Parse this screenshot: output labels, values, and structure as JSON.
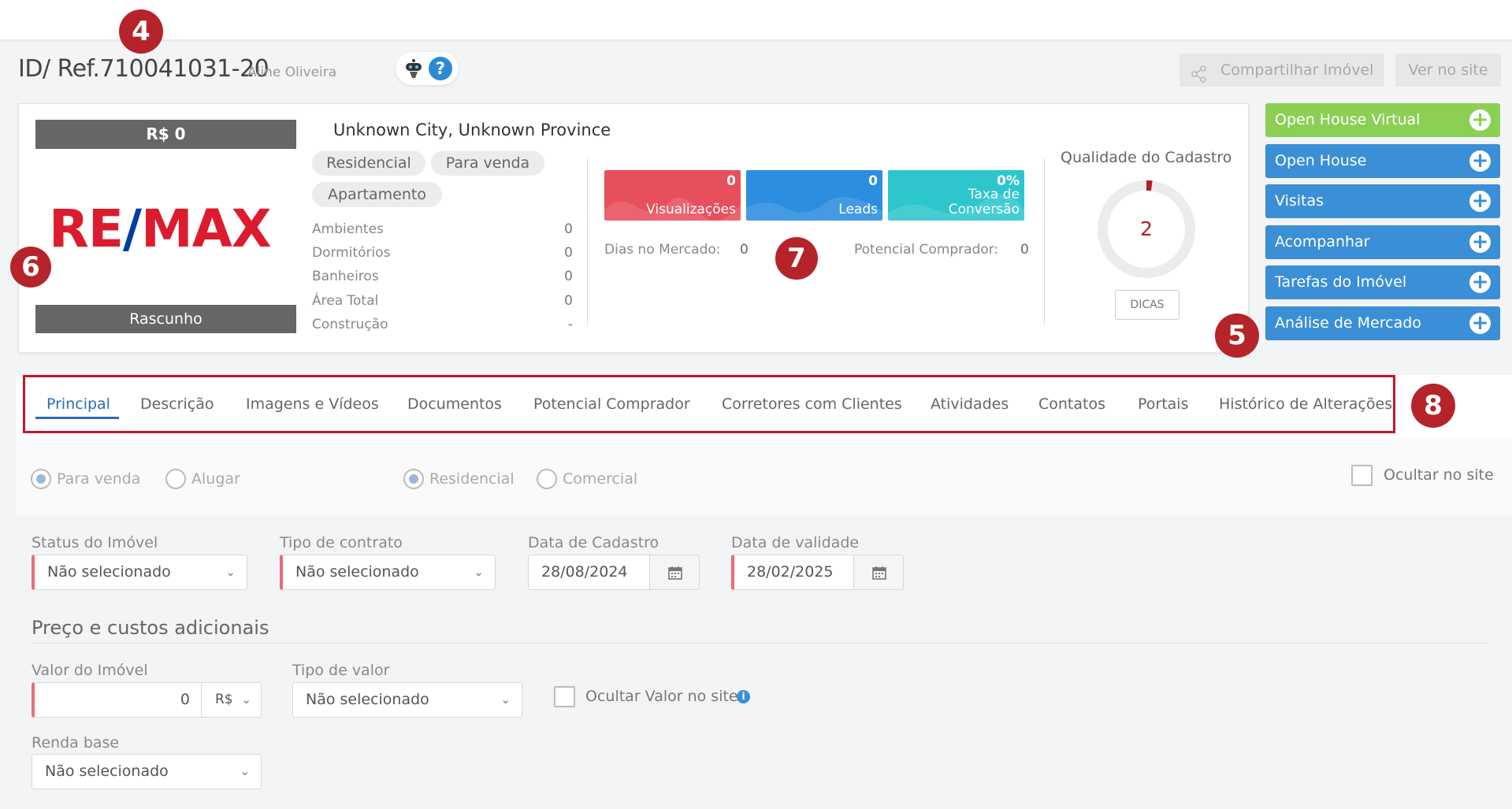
{
  "header": {
    "ref_title": "ID/ Ref.710041031-20",
    "agent_name": "Aline Oliveira",
    "share_label": "Compartilhar Imóvel",
    "view_site_label": "Ver no site"
  },
  "property": {
    "price": "R$ 0",
    "logo_left": "RE",
    "logo_slash": "/",
    "logo_right": "MAX",
    "status": "Rascunho",
    "location": "Unknown City, Unknown Province",
    "tags": [
      "Residencial",
      "Para venda",
      "Apartamento"
    ],
    "details": [
      {
        "label": "Ambientes",
        "value": "0"
      },
      {
        "label": "Dormitórios",
        "value": "0"
      },
      {
        "label": "Banheiros",
        "value": "0"
      },
      {
        "label": "Área Total",
        "value": "0"
      },
      {
        "label": "Construção",
        "value": "-"
      }
    ]
  },
  "stats": [
    {
      "value": "0",
      "label": "Visualizações",
      "color": "#e84f5c"
    },
    {
      "value": "0",
      "label": "Leads",
      "color": "#2c8ee0"
    },
    {
      "value": "0%",
      "label": "Taxa de Conversão",
      "color": "#2dc6cc"
    }
  ],
  "market": {
    "days_label": "Dias no Mercado:",
    "days_value": "0",
    "buyer_label": "Potencial Comprador:",
    "buyer_value": "0"
  },
  "quality": {
    "title": "Qualidade do Cadastro",
    "score": "2",
    "tips_label": "DICAS",
    "accent_color": "#b01f25"
  },
  "actions": [
    {
      "label": "Open House Virtual",
      "color": "#8bcf55"
    },
    {
      "label": "Open House",
      "color": "#3b8fd6"
    },
    {
      "label": "Visitas",
      "color": "#3b8fd6"
    },
    {
      "label": "Acompanhar",
      "color": "#3b8fd6"
    },
    {
      "label": "Tarefas do Imóvel",
      "color": "#3b8fd6"
    },
    {
      "label": "Análise de Mercado",
      "color": "#3b8fd6"
    }
  ],
  "badges": [
    "4",
    "5",
    "6",
    "7",
    "8"
  ],
  "tabs": [
    "Principal",
    "Descrição",
    "Imagens e Vídeos",
    "Documentos",
    "Potencial Comprador",
    "Corretores com Clientes",
    "Atividades",
    "Contatos",
    "Portais",
    "Histórico de Alterações"
  ],
  "active_tab": "Principal",
  "form": {
    "purpose_options": [
      "Para venda",
      "Alugar"
    ],
    "purpose_selected": "Para venda",
    "type_options": [
      "Residencial",
      "Comercial"
    ],
    "type_selected": "Residencial",
    "hide_on_site_label": "Ocultar no site",
    "status_label": "Status do Imóvel",
    "status_value": "Não selecionado",
    "contract_label": "Tipo de contrato",
    "contract_value": "Não selecionado",
    "register_date_label": "Data de Cadastro",
    "register_date_value": "28/08/2024",
    "validity_date_label": "Data de validade",
    "validity_date_value": "28/02/2025",
    "price_section_title": "Preço e custos adicionais",
    "value_label": "Valor do Imóvel",
    "value_value": "0",
    "currency": "R$",
    "value_type_label": "Tipo de valor",
    "value_type_value": "Não selecionado",
    "hide_value_label": "Ocultar Valor no site",
    "base_income_label": "Renda base",
    "base_income_value": "Não selecionado"
  },
  "colors": {
    "brand_red": "#dc1c2e",
    "brand_blue": "#003da5",
    "badge_red": "#b5242a",
    "tab_active": "#2a6db8",
    "required_marker": "#ef6b72"
  }
}
